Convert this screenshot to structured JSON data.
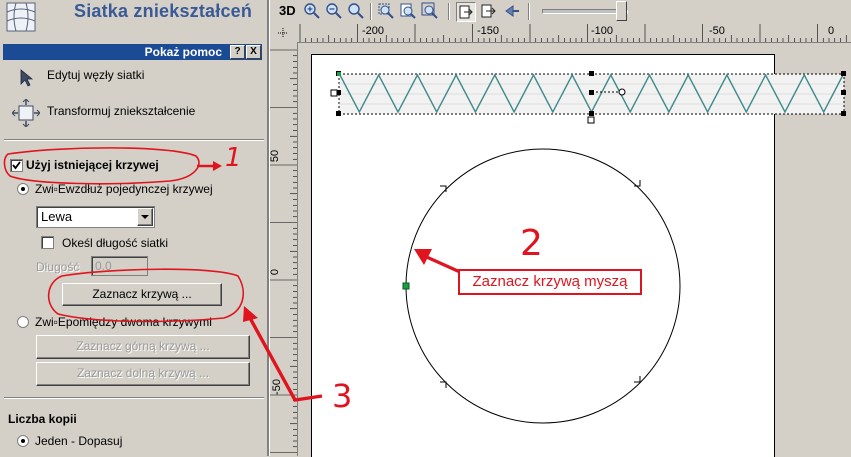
{
  "panel": {
    "title": "Siatka zniekształceń",
    "help_label": "Pokaż pomoc",
    "help_btn": "?",
    "close_btn": "X",
    "cmd_edit": "Edytuj węzły siatki",
    "cmd_transform": "Transformuj zniekształcenie",
    "use_existing_curve": "Użyj istniejącej krzywej",
    "along_single": "Zwi▫Ewzdłuż pojedynczej krzywej",
    "side_select": "Lewa",
    "specify_length": "Okeśl długość siatki",
    "length_label": "Długość",
    "length_value": "0.0",
    "select_curve_btn": "Zaznacz krzywą ...",
    "between_two": "Zwi▫Epomiędzy dwoma krzywymi",
    "select_top_btn": "Zaznacz górną krzywą ...",
    "select_bottom_btn": "Zaznacz dolną krzywą ...",
    "copies_heading": "Liczba kopii",
    "copies_option": "Jeden - Dopasuj"
  },
  "toolbar": {
    "label_3d": "3D"
  },
  "ruler": {
    "h_labels": [
      "-200",
      "-150",
      "-100",
      "-50",
      "0"
    ],
    "v_labels": [
      "50",
      "0",
      "-50"
    ]
  },
  "annotations": {
    "n1": "1",
    "n2": "2",
    "n3": "3",
    "callout": "Zaznacz krzywą myszą",
    "color": "#e0141e"
  }
}
